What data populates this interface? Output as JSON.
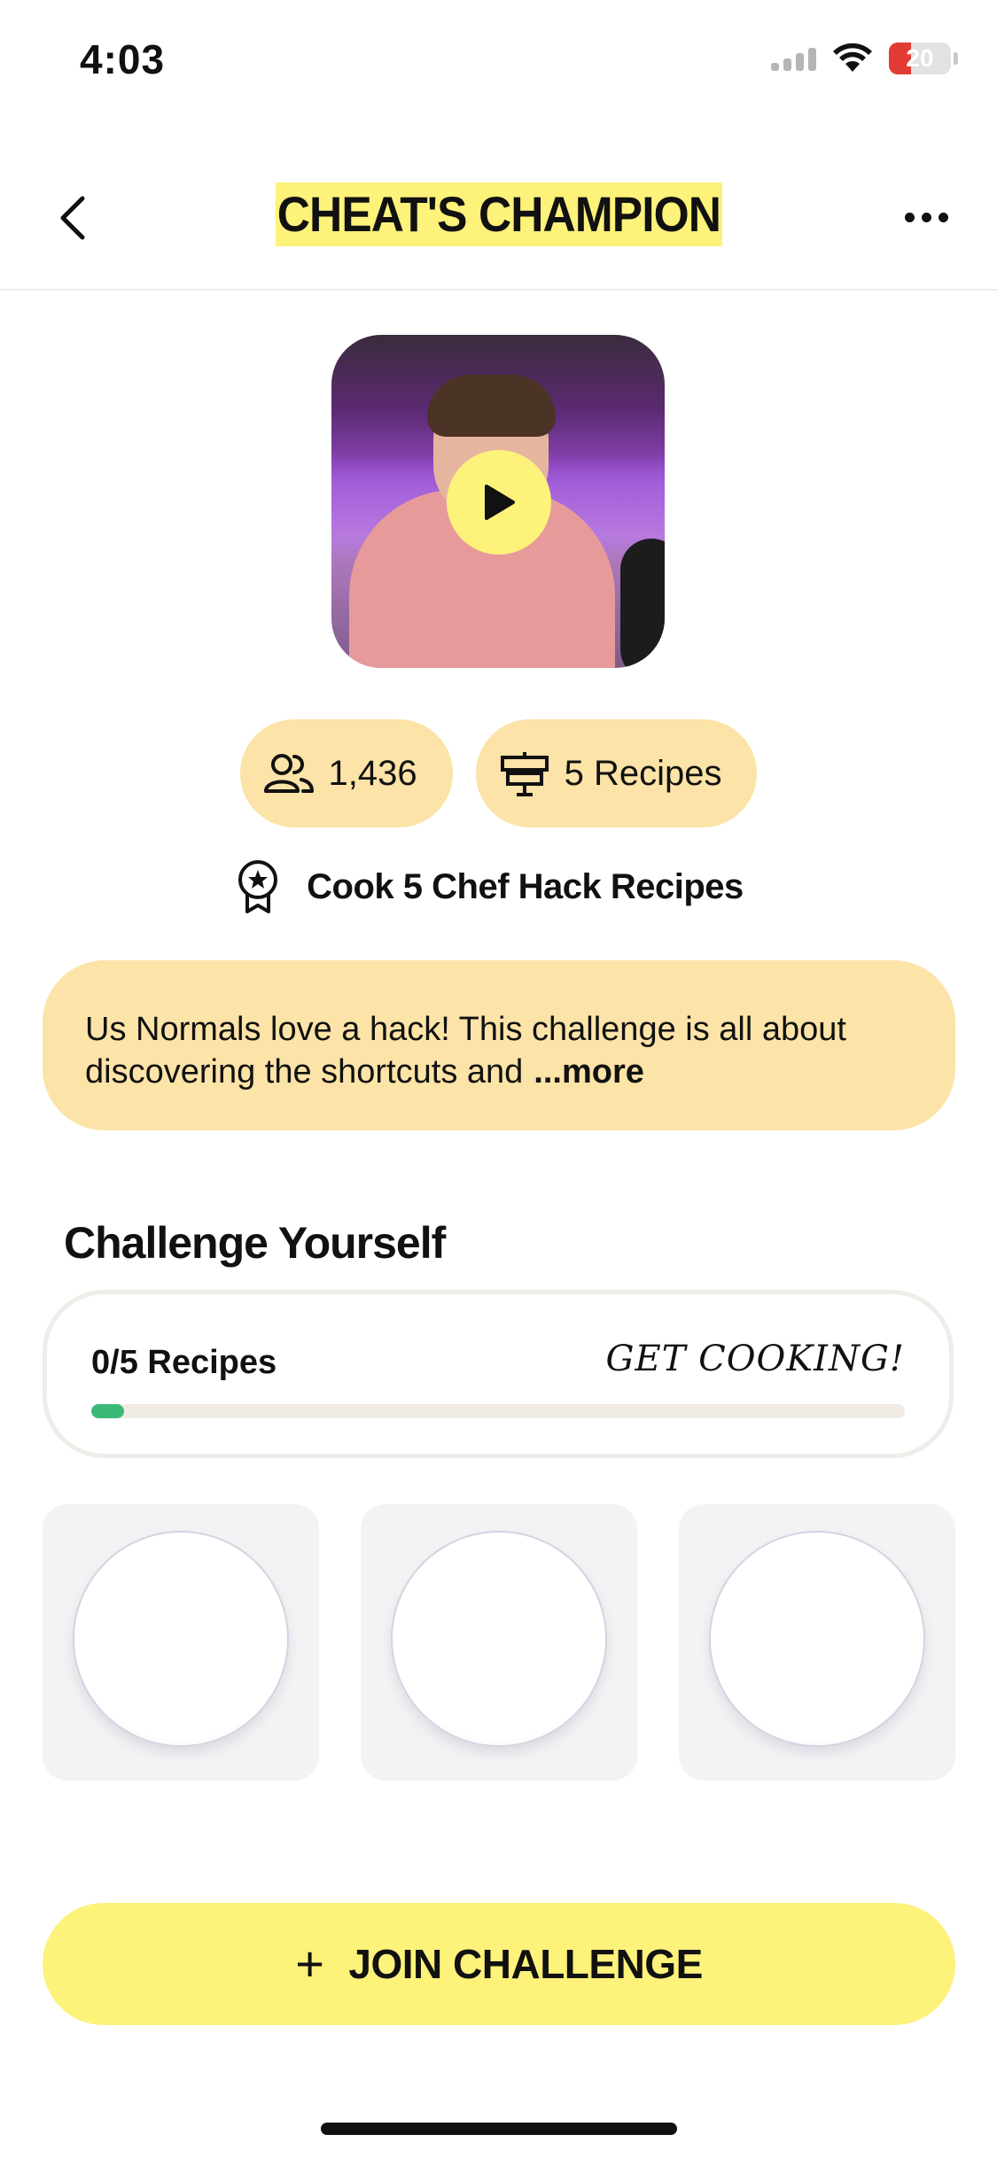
{
  "status_bar": {
    "time": "4:03",
    "battery": "20",
    "icons": [
      "signal-icon",
      "wifi-icon",
      "battery-icon"
    ]
  },
  "header": {
    "title": "CHEAT'S CHAMPION",
    "back_icon": "chevron-left-icon",
    "more_icon": "more-horizontal-icon",
    "title_highlight_color": "#fdf27a"
  },
  "media": {
    "play_icon": "play-icon"
  },
  "stats": {
    "participants": "1,436",
    "participants_icon": "users-icon",
    "recipes": "5 Recipes",
    "recipes_icon": "signpost-icon"
  },
  "goal": {
    "icon": "award-badge-icon",
    "text": "Cook 5 Chef Hack Recipes"
  },
  "description": {
    "text": "Us Normals love a hack! This challenge is all about discovering the shortcuts and",
    "more_label": "...more"
  },
  "challenge": {
    "section_title": "Challenge Yourself",
    "progress_label": "0/5 Recipes",
    "cta": "GET COOKING!",
    "progress_completed": 0,
    "progress_total": 5,
    "progress_color": "#3cb977"
  },
  "plates": [
    {
      "state": "empty"
    },
    {
      "state": "empty"
    },
    {
      "state": "empty"
    }
  ],
  "join_button": {
    "icon": "plus-icon",
    "label": "JOIN CHALLENGE",
    "color": "#fdf27a"
  }
}
